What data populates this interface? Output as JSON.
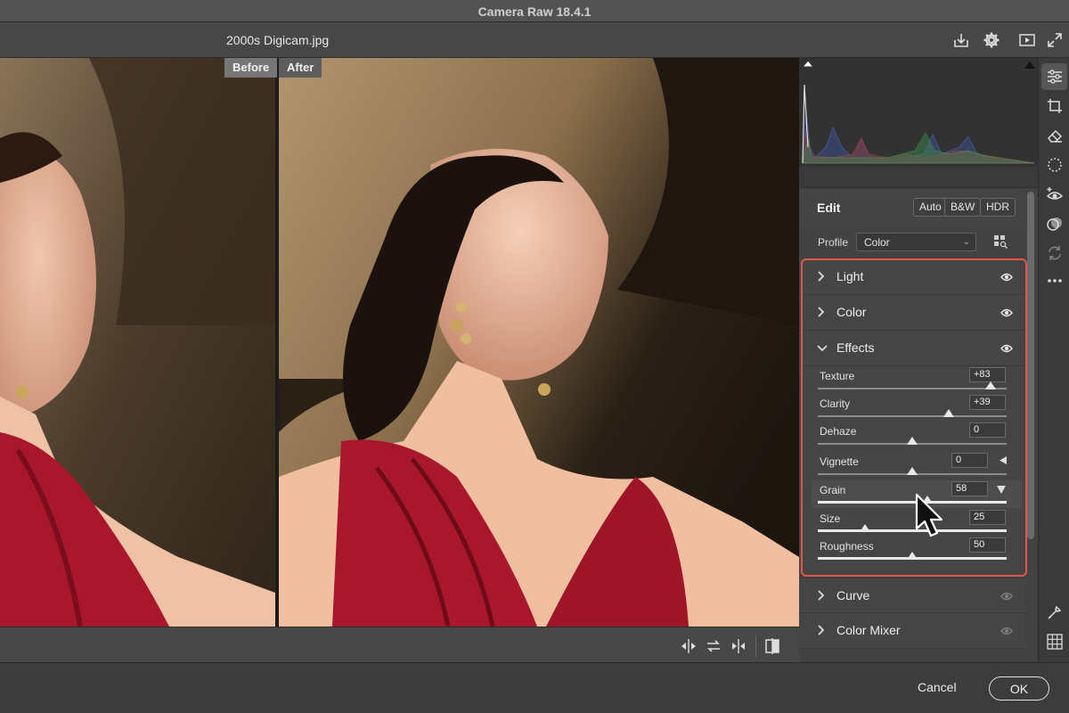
{
  "app": {
    "title": "Camera Raw 18.4.1"
  },
  "toolbar": {
    "filename": "2000s Digicam.jpg",
    "icons": [
      "save-icon",
      "gear-icon",
      "slideshow-icon",
      "fullscreen-icon"
    ]
  },
  "preview": {
    "before_label": "Before",
    "after_label": "After"
  },
  "bottom_tools": [
    "swap-before-after-icon",
    "copy-settings-icon",
    "split-view-icon",
    "compare-layout-icon"
  ],
  "edit": {
    "title": "Edit",
    "buttons": {
      "auto": "Auto",
      "bw": "B&W",
      "hdr": "HDR"
    },
    "profile_label": "Profile",
    "profile_value": "Color"
  },
  "sections": {
    "light": "Light",
    "color": "Color",
    "effects": "Effects",
    "curve": "Curve",
    "color_mixer": "Color Mixer"
  },
  "effects": {
    "texture": {
      "label": "Texture",
      "value": "+83",
      "level": 91.5
    },
    "clarity": {
      "label": "Clarity",
      "value": "+39",
      "level": 69.5
    },
    "dehaze": {
      "label": "Dehaze",
      "value": "0",
      "level": 50
    },
    "vignette": {
      "label": "Vignette",
      "value": "0",
      "level": 50
    },
    "grain": {
      "label": "Grain",
      "value": "58",
      "level": 58
    },
    "size": {
      "label": "Size",
      "value": "25",
      "level": 25
    },
    "roughness": {
      "label": "Roughness",
      "value": "50",
      "level": 50
    }
  },
  "footer": {
    "cancel": "Cancel",
    "ok": "OK"
  },
  "colors": {
    "accent_highlight": "#e4554d",
    "panel_bg": "#424242",
    "dress_red": "#a8172c"
  },
  "rail_icons": [
    "sliders-icon",
    "crop-icon",
    "eraser-icon",
    "mask-icon",
    "redeye-icon",
    "presets-icon",
    "sync-icon",
    "more-icon",
    "eyedropper-icon",
    "grid-icon"
  ]
}
